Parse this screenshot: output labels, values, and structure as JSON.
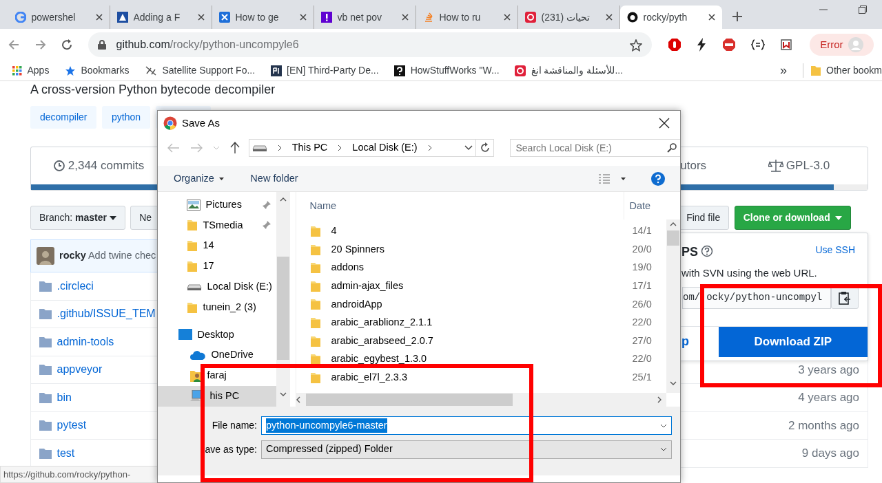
{
  "browser": {
    "tabs": [
      {
        "title": "powershel",
        "selected": false
      },
      {
        "title": "Adding a F",
        "selected": false
      },
      {
        "title": "How to ge",
        "selected": false
      },
      {
        "title": "vb net pov",
        "selected": false
      },
      {
        "title": "How to ru",
        "selected": false
      },
      {
        "title": "(231) تحيات",
        "selected": false
      },
      {
        "title": "rocky/pyth",
        "selected": true
      }
    ],
    "address": {
      "host": "github.com",
      "path": "/rocky/python-uncompyle6"
    },
    "profile_label": "Error",
    "bookmarks": [
      {
        "label": "Apps"
      },
      {
        "label": "Bookmarks"
      },
      {
        "label": "Satellite Support Fo..."
      },
      {
        "label": "[EN] Third-Party De..."
      },
      {
        "label": "HowStuffWorks \"W..."
      },
      {
        "label": "للأسئلة والمناقشة انغ..."
      }
    ],
    "bookmarks_more": "»",
    "other_bookmarks": "Other bookm"
  },
  "repo": {
    "description": "A cross-version Python bytecode decompiler",
    "topics": [
      "decompiler",
      "python"
    ],
    "stats": [
      {
        "label": "2,344 commits"
      },
      {
        "label": "utors"
      },
      {
        "label": "GPL-3.0"
      }
    ],
    "branch_label": "Branch:",
    "branch": "master",
    "new_button": "Ne",
    "find_file": "Find file",
    "clone_button": "Clone or download",
    "commit": {
      "author": "rocky",
      "message": "Add twine chec"
    },
    "files": [
      {
        "name": ".circleci"
      },
      {
        "name": ".github/ISSUE_TEM"
      },
      {
        "name": "admin-tools"
      },
      {
        "name": "appveyor",
        "age": "3 years ago"
      },
      {
        "name": "bin",
        "age": "4 years ago"
      },
      {
        "name": "pytest",
        "age": "2 months ago"
      },
      {
        "name": "test",
        "age": "9 days ago"
      }
    ],
    "status_url": "https://github.com/rocky/python-"
  },
  "clone_popover": {
    "title": "PS",
    "use_ssh": "Use SSH",
    "hint": "with SVN using the web URL.",
    "url_parts": [
      "om/",
      "ocky/python-uncompyl"
    ],
    "open_desktop": "p",
    "download_zip": "Download ZIP"
  },
  "save_dialog": {
    "title": "Save As",
    "breadcrumb": [
      "This PC",
      "Local Disk (E:)"
    ],
    "search": {
      "placeholder": "Search Local Disk (E:)"
    },
    "organize": "Organize",
    "new_folder": "New folder",
    "nav_pane": [
      {
        "label": "Pictures",
        "kind": "pictures",
        "pinned": true,
        "selected": false
      },
      {
        "label": "TSmedia",
        "kind": "folder",
        "pinned": true,
        "selected": false
      },
      {
        "label": "14",
        "kind": "folder",
        "pinned": false,
        "selected": false
      },
      {
        "label": "17",
        "kind": "folder",
        "pinned": false,
        "selected": false
      },
      {
        "label": "Local Disk (E:)",
        "kind": "drive",
        "pinned": false,
        "selected": false
      },
      {
        "label": "tunein_2 (3)",
        "kind": "folder",
        "pinned": false,
        "selected": false
      },
      {
        "label": "Desktop",
        "kind": "desktop",
        "pinned": false,
        "selected": false,
        "children": [
          {
            "label": "OneDrive",
            "kind": "cloud",
            "pinned": false,
            "selected": false
          },
          {
            "label": "faraj",
            "kind": "user",
            "pinned": false,
            "selected": false
          },
          {
            "label": "his PC",
            "kind": "pc",
            "pinned": false,
            "selected": true
          }
        ]
      }
    ],
    "columns": [
      "Name",
      "Date"
    ],
    "files": [
      {
        "name": "4",
        "date": "14/1"
      },
      {
        "name": "20 Spinners",
        "date": "20/0"
      },
      {
        "name": "addons",
        "date": "19/0"
      },
      {
        "name": "admin-ajax_files",
        "date": "17/1"
      },
      {
        "name": "androidApp",
        "date": "26/0"
      },
      {
        "name": "arabic_arablionz_2.1.1",
        "date": "22/0"
      },
      {
        "name": "arabic_arabseed_2.0.7",
        "date": "27/0"
      },
      {
        "name": "arabic_egybest_1.3.0",
        "date": "22/0"
      },
      {
        "name": "arabic_el7l_2.3.3",
        "date": "25/1"
      }
    ],
    "file_name_label": "File name:",
    "file_name": "python-uncompyle6-master",
    "type_label": "ave as type:",
    "type": "Compressed (zipped) Folder"
  }
}
